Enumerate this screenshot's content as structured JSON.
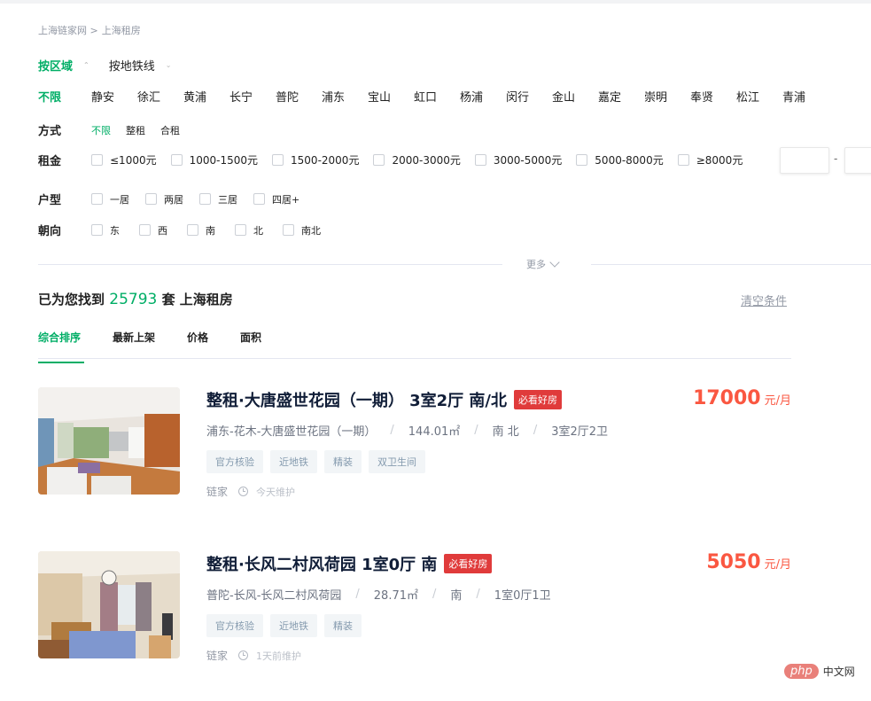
{
  "breadcrumb": [
    "上海链家网 >",
    "上海租房"
  ],
  "search_mode": [
    {
      "label": "按区域",
      "active": true
    },
    {
      "label": "按地铁线",
      "active": false
    }
  ],
  "districts": [
    "不限",
    "静安",
    "徐汇",
    "黄浦",
    "长宁",
    "普陀",
    "浦东",
    "宝山",
    "虹口",
    "杨浦",
    "闵行",
    "金山",
    "嘉定",
    "崇明",
    "奉贤",
    "松江",
    "青浦"
  ],
  "filters": {
    "mode": {
      "label": "方式",
      "options": [
        "不限",
        "整租",
        "合租"
      ],
      "selected": "不限"
    },
    "rent": {
      "label": "租金",
      "options": [
        "≤1000元",
        "1000-1500元",
        "1500-2000元",
        "2000-3000元",
        "3000-5000元",
        "5000-8000元",
        "≥8000元"
      ],
      "min_value": "",
      "max_value": "",
      "dash": "-"
    },
    "layout": {
      "label": "户型",
      "options": [
        "一居",
        "两居",
        "三居",
        "四居+"
      ]
    },
    "orientation": {
      "label": "朝向",
      "options": [
        "东",
        "西",
        "南",
        "北",
        "南北"
      ]
    }
  },
  "more_label": "更多",
  "results": {
    "prefix": "已为您找到",
    "count": "25793",
    "suffix": "套 上海租房",
    "clear_label": "清空条件"
  },
  "sort_tabs": [
    {
      "label": "综合排序",
      "active": true
    },
    {
      "label": "最新上架",
      "active": false
    },
    {
      "label": "价格",
      "active": false
    },
    {
      "label": "面积",
      "active": false
    }
  ],
  "listings": [
    {
      "title": "整租·大唐盛世花园（一期） 3室2厅 南/北",
      "badge": "必看好房",
      "location": "浦东-花木-大唐盛世花园（一期）",
      "area": "144.01㎡",
      "orientation": "南 北",
      "layout": "3室2厅2卫",
      "tags": [
        "官方核验",
        "近地铁",
        "精装",
        "双卫生间"
      ],
      "brand": "链家",
      "updated": "今天维护",
      "price": "17000",
      "price_unit": "元/月"
    },
    {
      "title": "整租·长风二村风荷园 1室0厅 南",
      "badge": "必看好房",
      "location": "普陀-长风-长风二村风荷园",
      "area": "28.71㎡",
      "orientation": "南",
      "layout": "1室0厅1卫",
      "tags": [
        "官方核验",
        "近地铁",
        "精装"
      ],
      "brand": "链家",
      "updated": "1天前维护",
      "price": "5050",
      "price_unit": "元/月"
    }
  ],
  "watermark": {
    "pill": "php",
    "text": "中文网"
  }
}
